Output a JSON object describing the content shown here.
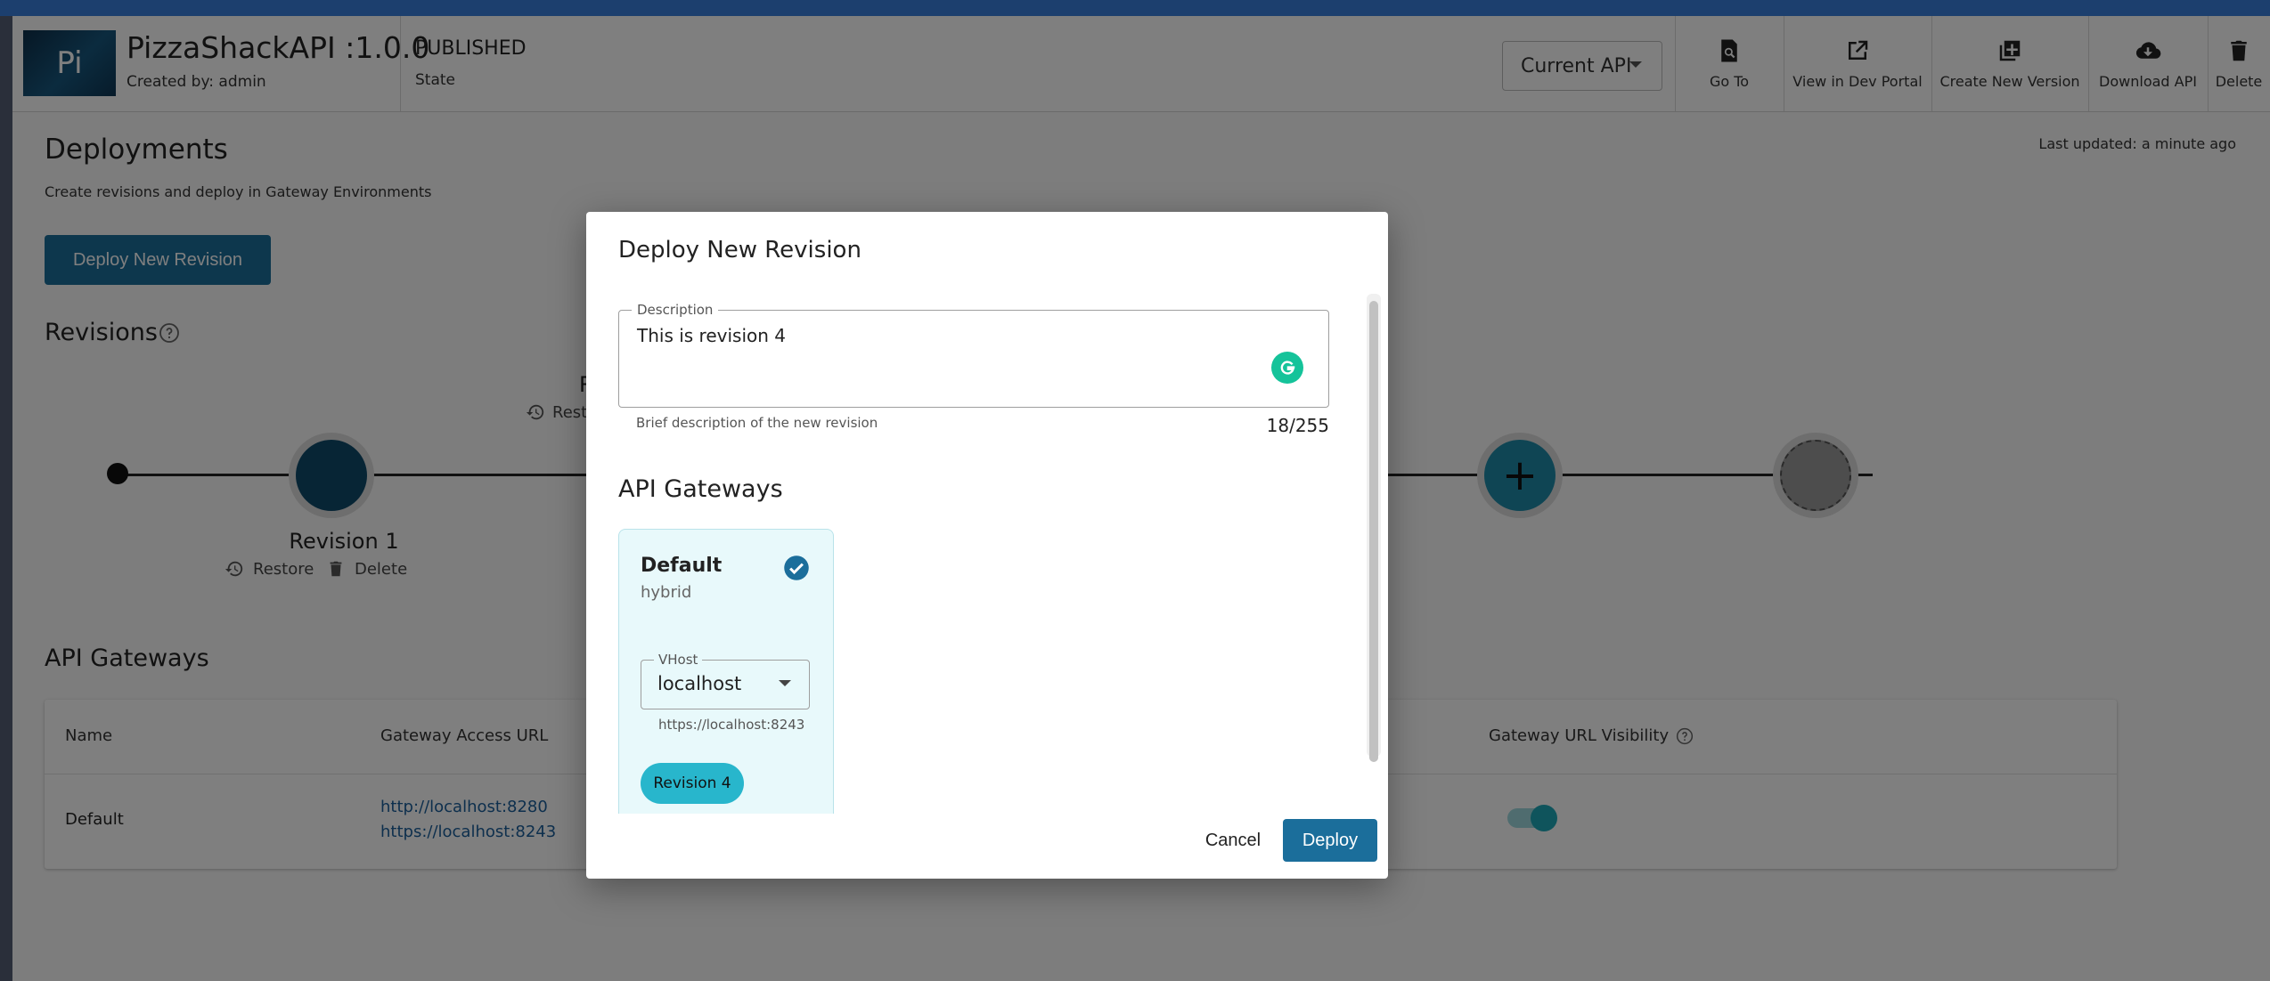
{
  "header": {
    "avatar_text": "Pi",
    "api_title": "PizzaShackAPI :1.0.0",
    "created_by": "Created by: admin",
    "state_value": "PUBLISHED",
    "state_label": "State",
    "current_api_label": "Current API",
    "tools": [
      {
        "label": "Go To",
        "icon": "document-search-icon"
      },
      {
        "label": "View in Dev Portal",
        "icon": "external-link-icon"
      },
      {
        "label": "Create New Version",
        "icon": "add-box-icon"
      },
      {
        "label": "Download API",
        "icon": "cloud-download-icon"
      },
      {
        "label": "Delete",
        "icon": "trash-icon"
      }
    ]
  },
  "deployments": {
    "title": "Deployments",
    "subtitle": "Create revisions and deploy in Gateway Environments",
    "last_updated": "Last updated: a minute ago",
    "deploy_button": "Deploy New Revision",
    "revisions_title": "Revisions"
  },
  "timeline": {
    "revision1_label": "Revision 1",
    "restore": "Restore",
    "delete": "Delete",
    "partial_label": "R",
    "partial_restore": "Rest"
  },
  "gateways": {
    "title": "API Gateways",
    "columns": [
      "Name",
      "Gateway Access URL",
      "Gateway URL Visibility"
    ],
    "rows": [
      {
        "name": "Default",
        "url_http": "http://localhost:8280",
        "url_https": "https://localhost:8243",
        "visibility_on": true
      }
    ]
  },
  "dialog": {
    "title": "Deploy New Revision",
    "description_label": "Description",
    "description_value": "This is revision 4",
    "description_helper": "Brief description of the new revision",
    "char_count": "18/255",
    "gateways_title": "API Gateways",
    "card": {
      "name": "Default",
      "type": "hybrid",
      "vhost_label": "VHost",
      "vhost_value": "localhost",
      "vhost_url": "https://localhost:8243",
      "revision_chip": "Revision 4"
    },
    "cancel": "Cancel",
    "deploy": "Deploy"
  },
  "colors": {
    "primary": "#1b6e9b",
    "accent_teal": "#1ea8b8",
    "card_bg": "#e8f9fb",
    "grammarly": "#15c39a"
  }
}
